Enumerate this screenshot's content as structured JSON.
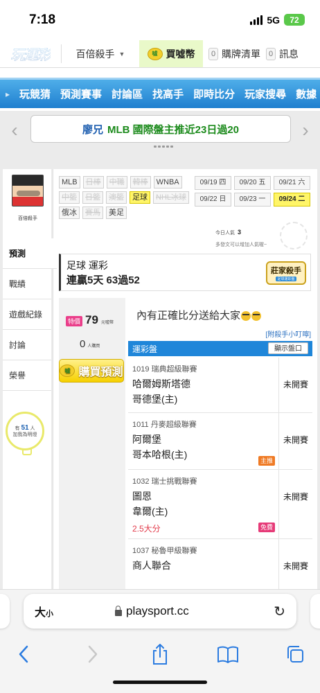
{
  "status_bar": {
    "time": "7:18",
    "network": "5G",
    "battery": "72"
  },
  "header": {
    "logo": "玩運彩",
    "killer_menu": "百倍殺手",
    "buy_coin": "買噓幣",
    "coin_icon_text": "噓",
    "cart_count": "0",
    "cart_label": "購牌清單",
    "msg_count": "0",
    "msg_label": "訊息"
  },
  "nav": {
    "items": [
      "玩競猜",
      "預測賽事",
      "討論區",
      "找高手",
      "即時比分",
      "玩家搜尋",
      "數據"
    ]
  },
  "carousel": {
    "expert": "廖兄",
    "headline": "MLB 國際盤主推近23日過20"
  },
  "sidebar": {
    "user_label": "百倍殺手",
    "menu": [
      "預測",
      "戰績",
      "遊戲紀錄",
      "討論",
      "榮譽"
    ],
    "bulb_prefix": "有",
    "bulb_count": "51",
    "bulb_unit": "人",
    "bulb_text": "加我為明燈"
  },
  "filters": {
    "chips": [
      {
        "label": "MLB",
        "state": "normal"
      },
      {
        "label": "日棒",
        "state": "dim"
      },
      {
        "label": "中職",
        "state": "dim"
      },
      {
        "label": "韓棒",
        "state": "dim"
      },
      {
        "label": "WNBA",
        "state": "normal"
      },
      {
        "label": "中籃",
        "state": "dim"
      },
      {
        "label": "日籃",
        "state": "dim"
      },
      {
        "label": "澳籃",
        "state": "dim"
      },
      {
        "label": "足球",
        "state": "active"
      },
      {
        "label": "NHL冰球",
        "state": "dim"
      },
      {
        "label": "俄冰",
        "state": "normal"
      },
      {
        "label": "賽馬",
        "state": "dim"
      },
      {
        "label": "美足",
        "state": "normal"
      }
    ],
    "dates": [
      {
        "label": "09/19 四",
        "active": false
      },
      {
        "label": "09/20 五",
        "active": false
      },
      {
        "label": "09/21 六",
        "active": false
      },
      {
        "label": "09/22 日",
        "active": false
      },
      {
        "label": "09/23 一",
        "active": false
      },
      {
        "label": "09/24 二",
        "active": true
      }
    ],
    "visits_label": "今日人氣",
    "visits_count": "3",
    "hint": "多發文可以增加人氣喔~"
  },
  "title_card": {
    "line1": "足球 運彩",
    "line2": "連贏5天 63過52",
    "badge": "莊家殺手",
    "badge_sub": "足球運彩盤"
  },
  "purchase": {
    "special_tag": "特價",
    "price": "79",
    "price_unit": "元噓幣",
    "buyers": "0",
    "buyers_unit": "人購買",
    "buy_button": "購買預測"
  },
  "board": {
    "announce": "內有正確比分送給大家",
    "handbook_link": "[附殺手小叮嚀]",
    "table_title": "運彩盤",
    "show_button": "顯示盤口",
    "games": [
      {
        "league": "1019 瑞典超級聯賽",
        "away": "哈爾姆斯塔德",
        "home": "哥德堡(主)",
        "status": "未開賽",
        "tag": "",
        "pick": ""
      },
      {
        "league": "1011 丹麥超級聯賽",
        "away": "阿爾堡",
        "home": "哥本哈根(主)",
        "status": "未開賽",
        "tag": "主推",
        "pick": ""
      },
      {
        "league": "1032 瑞士挑戰聯賽",
        "away": "圖恩",
        "home": "韋爾(主)",
        "status": "未開賽",
        "tag": "免費",
        "pick": "2.5大分"
      },
      {
        "league": "1037 秘魯甲級聯賽",
        "away": "商人聯合",
        "home": "",
        "status": "未開賽",
        "tag": "",
        "pick": ""
      }
    ]
  },
  "safari": {
    "text_size": "大",
    "text_size_small": "小",
    "url": "playsport.cc"
  }
}
